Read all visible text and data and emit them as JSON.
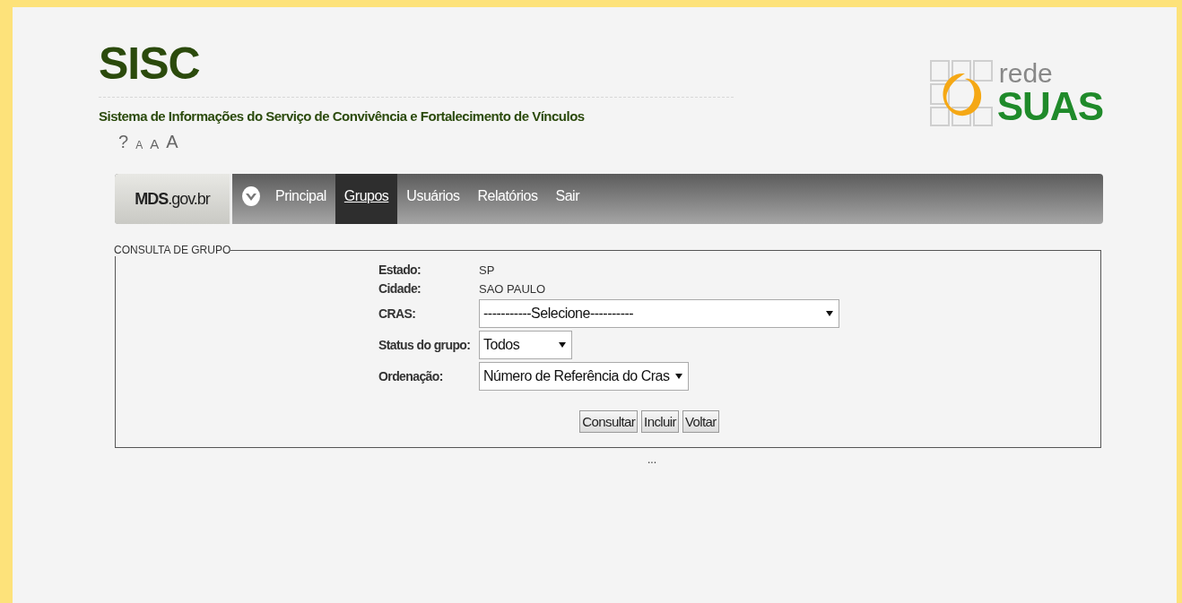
{
  "header": {
    "title": "SISC",
    "subtitle": "Sistema de Informações do Serviço de Convivência e Fortalecimento de Vínculos",
    "tools": [
      "?",
      "A",
      "A",
      "A"
    ],
    "logo": {
      "top": "rede",
      "bottom": "SUAS"
    }
  },
  "nav": {
    "brand_bold": "MDS",
    "brand_rest": ".gov.br",
    "items": [
      {
        "label": "Principal",
        "selected": false
      },
      {
        "label": "Grupos",
        "selected": true
      },
      {
        "label": "Usuários",
        "selected": false
      },
      {
        "label": "Relatórios",
        "selected": false
      },
      {
        "label": "Sair",
        "selected": false
      }
    ]
  },
  "form": {
    "legend": "CONSULTA DE GRUPO",
    "fields": [
      {
        "kind": "text",
        "label": "Estado:",
        "value": "SP"
      },
      {
        "kind": "text",
        "label": "Cidade:",
        "value": "SAO PAULO"
      },
      {
        "kind": "select",
        "label": "CRAS:",
        "value": "-----------Selecione----------"
      },
      {
        "kind": "select",
        "label": "Status do grupo:",
        "value": "Todos"
      },
      {
        "kind": "select",
        "label": "Ordenação:",
        "value": "Número de Referência do Cras"
      }
    ],
    "buttons": [
      "Consultar",
      "Incluir",
      "Voltar"
    ],
    "footer": "..."
  }
}
